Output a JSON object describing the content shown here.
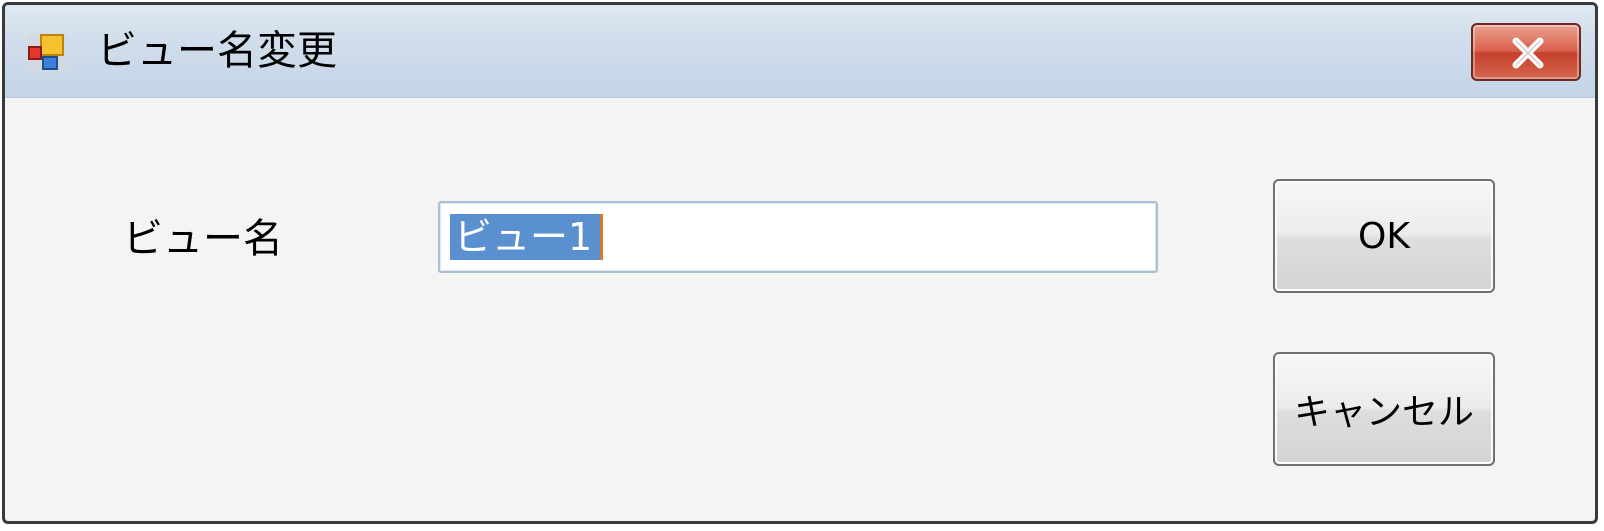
{
  "window": {
    "title": "ビュー名変更",
    "icon": "app-window-icon",
    "close_icon": "close-x-icon"
  },
  "form": {
    "label": "ビュー名",
    "input_value": "ビュー1",
    "input_selected": true
  },
  "buttons": {
    "ok_label": "OK",
    "cancel_label": "キャンセル"
  },
  "colors": {
    "selection": "#5a8fd0",
    "close_button": "#c5412c",
    "caret": "#d9782a"
  }
}
